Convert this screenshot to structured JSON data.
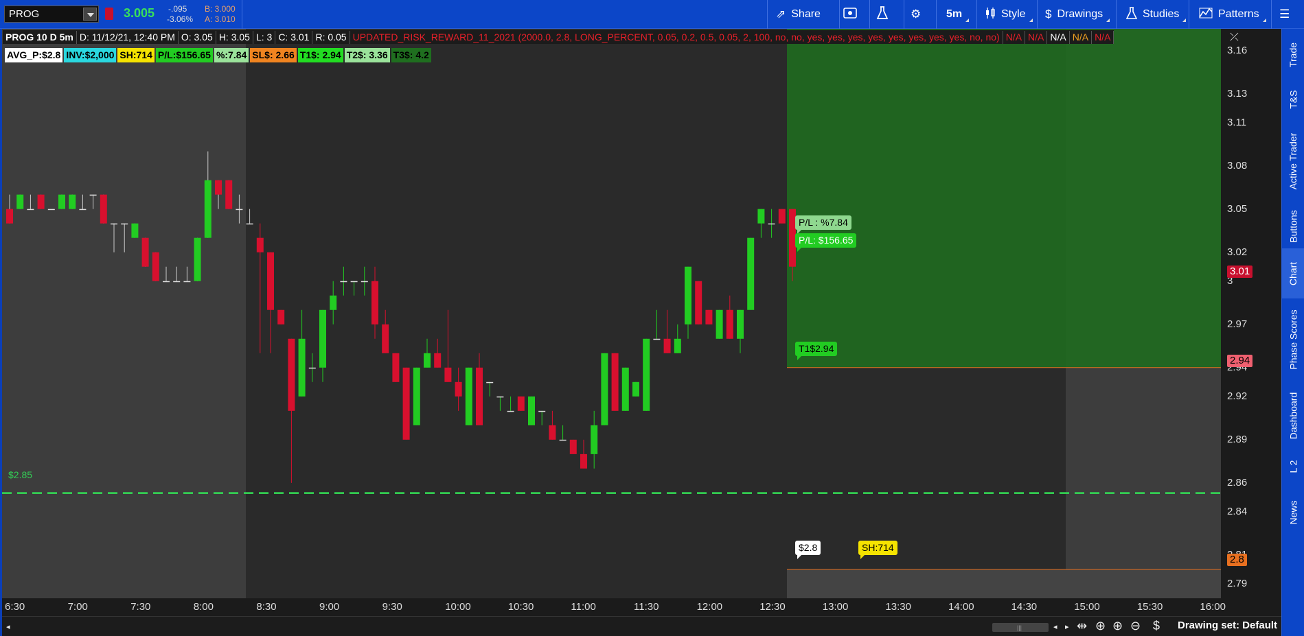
{
  "toolbar": {
    "symbol": "PROG",
    "last_price": "3.005",
    "net_change": "-.095",
    "pct_change": "-3.06%",
    "bid": "B: 3.000",
    "ask": "A: 3.010",
    "buttons": {
      "share": "Share",
      "timeframe": "5m",
      "style": "Style",
      "drawings": "Drawings",
      "studies": "Studies",
      "patterns": "Patterns"
    }
  },
  "side_tabs": [
    "Trade",
    "T&S",
    "Active Trader",
    "Buttons",
    "Chart",
    "Phase Scores",
    "Dashboard",
    "L 2",
    "News"
  ],
  "header": {
    "title": "PROG 10 D 5m",
    "date": "D: 11/12/21, 12:40 PM",
    "open": "O: 3.05",
    "high": "H: 3.05",
    "low": "L: 3",
    "close": "C: 3.01",
    "range": "R: 0.05",
    "study": "UPDATED_RISK_REWARD_11_2021 (2000.0, 2.8, LONG_PERCENT, 0.05, 0.2, 0.5, 0.05, 2, 100, no, no, yes, yes, yes, yes, yes, yes, yes, yes, no, no)",
    "na_values": [
      "N/A",
      "N/A",
      "N/A",
      "N/A",
      "N/A"
    ]
  },
  "labels": [
    {
      "text": "AVG_P:$2.8",
      "bg": "#ffffff"
    },
    {
      "text": "INV:$2,000",
      "bg": "#2ad8e0"
    },
    {
      "text": "SH:714",
      "bg": "#f5e300"
    },
    {
      "text": "P/L:$156.65",
      "bg": "#22cc22"
    },
    {
      "text": "%:7.84",
      "bg": "#9be39b"
    },
    {
      "text": "SL$: 2.66",
      "bg": "#f08420"
    },
    {
      "text": "T1$: 2.94",
      "bg": "#22dd22"
    },
    {
      "text": "T2$: 3.36",
      "bg": "#9be39b"
    },
    {
      "text": "T3$: 4.2",
      "bg": "#1f6e1f"
    }
  ],
  "y_axis": [
    "3.16",
    "3.13",
    "3.11",
    "3.08",
    "3.05",
    "3.02",
    "3",
    "2.97",
    "2.94",
    "2.92",
    "2.89",
    "2.86",
    "2.84",
    "2.81",
    "2.79"
  ],
  "x_axis": [
    "6:30",
    "7:00",
    "7:30",
    "8:00",
    "8:30",
    "9:00",
    "9:30",
    "10:00",
    "10:30",
    "11:00",
    "11:30",
    "12:00",
    "12:30",
    "13:00",
    "13:30",
    "14:00",
    "14:30",
    "15:00",
    "15:30",
    "16:00"
  ],
  "price_tags": {
    "current": "3.01",
    "target": "2.94",
    "avg": "2.8"
  },
  "bubbles": {
    "pl_pct": "P/L : %7.84",
    "pl_usd": "P/L:  $156.65",
    "t1": "T1$2.94",
    "avg": "$2.8",
    "shares": "SH:714"
  },
  "dashed_line_label": "$2.85",
  "bottom": {
    "drawing_set": "Drawing set: Default"
  },
  "colors": {
    "up": "#22cc22",
    "down": "#d8102e",
    "target_zone": "#1f6a1f",
    "dashed": "#33dd55"
  },
  "chart_data": {
    "type": "candlestick",
    "ylim": [
      2.78,
      3.175
    ],
    "candles": [
      {
        "o": 3.05,
        "h": 3.06,
        "l": 3.04,
        "c": 3.04
      },
      {
        "o": 3.05,
        "h": 3.06,
        "l": 3.05,
        "c": 3.06
      },
      {
        "o": 3.05,
        "h": 3.06,
        "l": 3.05,
        "c": 3.05
      },
      {
        "o": 3.06,
        "h": 3.06,
        "l": 3.05,
        "c": 3.05
      },
      {
        "o": 3.05,
        "h": 3.05,
        "l": 3.05,
        "c": 3.05
      },
      {
        "o": 3.05,
        "h": 3.06,
        "l": 3.05,
        "c": 3.06
      },
      {
        "o": 3.05,
        "h": 3.06,
        "l": 3.05,
        "c": 3.06
      },
      {
        "o": 3.05,
        "h": 3.06,
        "l": 3.05,
        "c": 3.05
      },
      {
        "o": 3.06,
        "h": 3.06,
        "l": 3.05,
        "c": 3.06
      },
      {
        "o": 3.06,
        "h": 3.06,
        "l": 3.04,
        "c": 3.04
      },
      {
        "o": 3.04,
        "h": 3.04,
        "l": 3.02,
        "c": 3.04
      },
      {
        "o": 3.04,
        "h": 3.04,
        "l": 3.02,
        "c": 3.04
      },
      {
        "o": 3.03,
        "h": 3.04,
        "l": 3.03,
        "c": 3.04
      },
      {
        "o": 3.03,
        "h": 3.03,
        "l": 3.01,
        "c": 3.01
      },
      {
        "o": 3.02,
        "h": 3.02,
        "l": 3.0,
        "c": 3.0
      },
      {
        "o": 3.0,
        "h": 3.01,
        "l": 3.0,
        "c": 3.0
      },
      {
        "o": 3.0,
        "h": 3.01,
        "l": 3.0,
        "c": 3.0
      },
      {
        "o": 3.0,
        "h": 3.01,
        "l": 3.0,
        "c": 3.0
      },
      {
        "o": 3.0,
        "h": 3.03,
        "l": 3.0,
        "c": 3.03
      },
      {
        "o": 3.03,
        "h": 3.09,
        "l": 3.03,
        "c": 3.07
      },
      {
        "o": 3.07,
        "h": 3.07,
        "l": 3.05,
        "c": 3.06
      },
      {
        "o": 3.07,
        "h": 3.07,
        "l": 3.05,
        "c": 3.05
      },
      {
        "o": 3.05,
        "h": 3.06,
        "l": 3.04,
        "c": 3.05
      },
      {
        "o": 3.04,
        "h": 3.05,
        "l": 3.04,
        "c": 3.04
      },
      {
        "o": 3.03,
        "h": 3.04,
        "l": 2.95,
        "c": 3.02
      },
      {
        "o": 3.02,
        "h": 3.02,
        "l": 2.95,
        "c": 2.98
      },
      {
        "o": 2.98,
        "h": 2.98,
        "l": 2.97,
        "c": 2.97
      },
      {
        "o": 2.96,
        "h": 2.96,
        "l": 2.86,
        "c": 2.91
      },
      {
        "o": 2.92,
        "h": 2.98,
        "l": 2.92,
        "c": 2.96
      },
      {
        "o": 2.94,
        "h": 2.95,
        "l": 2.93,
        "c": 2.94
      },
      {
        "o": 2.94,
        "h": 2.98,
        "l": 2.93,
        "c": 2.98
      },
      {
        "o": 2.98,
        "h": 3.0,
        "l": 2.97,
        "c": 2.99
      },
      {
        "o": 3.0,
        "h": 3.01,
        "l": 2.99,
        "c": 3.0
      },
      {
        "o": 3.0,
        "h": 3.0,
        "l": 2.99,
        "c": 3.0
      },
      {
        "o": 3.0,
        "h": 3.01,
        "l": 2.99,
        "c": 3.0
      },
      {
        "o": 3.0,
        "h": 3.01,
        "l": 2.96,
        "c": 2.97
      },
      {
        "o": 2.97,
        "h": 2.98,
        "l": 2.95,
        "c": 2.95
      },
      {
        "o": 2.95,
        "h": 2.95,
        "l": 2.93,
        "c": 2.93
      },
      {
        "o": 2.94,
        "h": 2.94,
        "l": 2.89,
        "c": 2.89
      },
      {
        "o": 2.9,
        "h": 2.94,
        "l": 2.9,
        "c": 2.94
      },
      {
        "o": 2.94,
        "h": 2.96,
        "l": 2.94,
        "c": 2.95
      },
      {
        "o": 2.95,
        "h": 2.96,
        "l": 2.94,
        "c": 2.94
      },
      {
        "o": 2.94,
        "h": 2.98,
        "l": 2.93,
        "c": 2.93
      },
      {
        "o": 2.93,
        "h": 2.94,
        "l": 2.91,
        "c": 2.92
      },
      {
        "o": 2.9,
        "h": 2.94,
        "l": 2.9,
        "c": 2.94
      },
      {
        "o": 2.94,
        "h": 2.95,
        "l": 2.9,
        "c": 2.9
      },
      {
        "o": 2.93,
        "h": 2.93,
        "l": 2.92,
        "c": 2.93
      },
      {
        "o": 2.92,
        "h": 2.92,
        "l": 2.91,
        "c": 2.92
      },
      {
        "o": 2.91,
        "h": 2.92,
        "l": 2.91,
        "c": 2.91
      },
      {
        "o": 2.92,
        "h": 2.92,
        "l": 2.91,
        "c": 2.91
      },
      {
        "o": 2.9,
        "h": 2.92,
        "l": 2.9,
        "c": 2.92
      },
      {
        "o": 2.91,
        "h": 2.91,
        "l": 2.9,
        "c": 2.91
      },
      {
        "o": 2.9,
        "h": 2.91,
        "l": 2.89,
        "c": 2.89
      },
      {
        "o": 2.89,
        "h": 2.9,
        "l": 2.89,
        "c": 2.89
      },
      {
        "o": 2.89,
        "h": 2.89,
        "l": 2.88,
        "c": 2.88
      },
      {
        "o": 2.88,
        "h": 2.89,
        "l": 2.87,
        "c": 2.87
      },
      {
        "o": 2.88,
        "h": 2.91,
        "l": 2.87,
        "c": 2.9
      },
      {
        "o": 2.9,
        "h": 2.95,
        "l": 2.9,
        "c": 2.95
      },
      {
        "o": 2.95,
        "h": 2.95,
        "l": 2.91,
        "c": 2.91
      },
      {
        "o": 2.91,
        "h": 2.94,
        "l": 2.91,
        "c": 2.94
      },
      {
        "o": 2.92,
        "h": 2.93,
        "l": 2.92,
        "c": 2.93
      },
      {
        "o": 2.91,
        "h": 2.96,
        "l": 2.91,
        "c": 2.96
      },
      {
        "o": 2.96,
        "h": 2.98,
        "l": 2.96,
        "c": 2.96
      },
      {
        "o": 2.96,
        "h": 2.98,
        "l": 2.95,
        "c": 2.95
      },
      {
        "o": 2.95,
        "h": 2.97,
        "l": 2.95,
        "c": 2.96
      },
      {
        "o": 2.97,
        "h": 3.01,
        "l": 2.96,
        "c": 3.01
      },
      {
        "o": 3.0,
        "h": 3.0,
        "l": 2.97,
        "c": 2.97
      },
      {
        "o": 2.98,
        "h": 2.98,
        "l": 2.97,
        "c": 2.97
      },
      {
        "o": 2.96,
        "h": 2.98,
        "l": 2.96,
        "c": 2.98
      },
      {
        "o": 2.98,
        "h": 2.99,
        "l": 2.96,
        "c": 2.96
      },
      {
        "o": 2.96,
        "h": 2.98,
        "l": 2.95,
        "c": 2.98
      },
      {
        "o": 2.98,
        "h": 3.03,
        "l": 2.98,
        "c": 3.03
      },
      {
        "o": 3.04,
        "h": 3.05,
        "l": 3.03,
        "c": 3.05
      },
      {
        "o": 3.04,
        "h": 3.05,
        "l": 3.03,
        "c": 3.04
      },
      {
        "o": 3.05,
        "h": 3.05,
        "l": 3.04,
        "c": 3.04
      },
      {
        "o": 3.05,
        "h": 3.05,
        "l": 3.0,
        "c": 3.01
      }
    ],
    "reference_lines": [
      {
        "label": "$2.85",
        "value": 2.853,
        "style": "dashed"
      },
      {
        "label": "T1$2.94",
        "value": 2.94
      },
      {
        "label": "AVG $2.8",
        "value": 2.8
      }
    ]
  }
}
